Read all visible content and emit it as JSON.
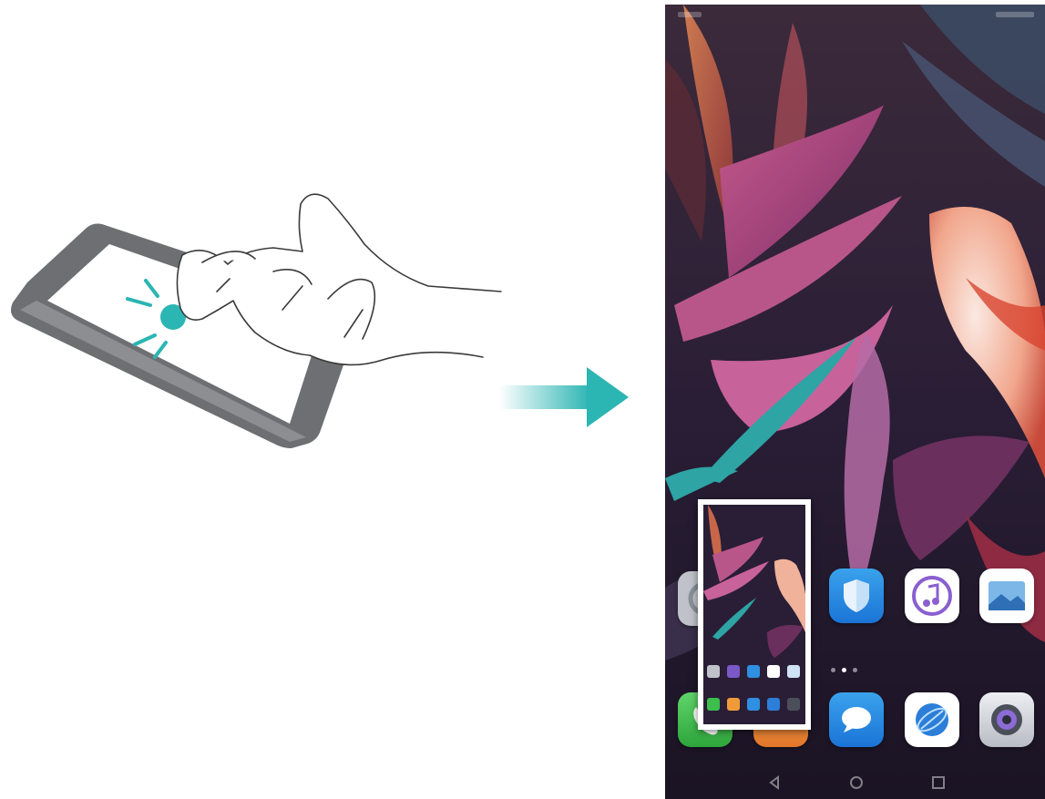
{
  "illustration": {
    "caption": "",
    "gesture": "knuckle-double-tap",
    "accent_color": "#2bb5b3"
  },
  "arrow": {
    "color": "#2bb5b3"
  },
  "phone": {
    "home_row_labels": [
      "",
      "",
      "",
      "",
      ""
    ],
    "icons_row1": [
      "settings-icon",
      "phone-manager-icon",
      "music-icon",
      "gallery-icon"
    ],
    "icons_row2": [
      "phone-call-icon",
      "contacts-icon",
      "messages-icon",
      "browser-icon",
      "camera-icon"
    ],
    "nav": [
      "back-icon",
      "home-icon",
      "recents-icon"
    ]
  }
}
